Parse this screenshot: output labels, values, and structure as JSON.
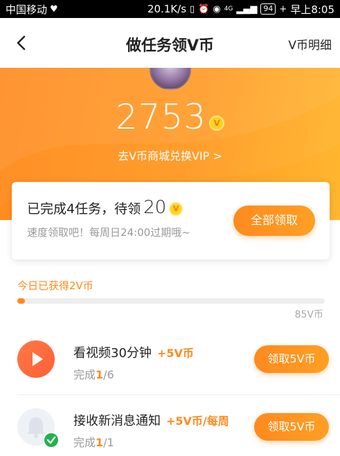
{
  "statusbar": {
    "carrier": "中国移动",
    "speed": "20.1K/s",
    "network": "4G",
    "battery": "94",
    "time": "早上8:05"
  },
  "nav": {
    "title": "做任务领V币",
    "right_link": "V币明细"
  },
  "hero": {
    "coin_total": "2753",
    "coin_symbol": "V",
    "exchange_link": "去V币商城兑换VIP >"
  },
  "summary_card": {
    "text_prefix": "已完成4任务，待领",
    "pending_amount": "20",
    "coin_symbol": "V",
    "hint": "速度领取吧！每周日24:00过期哦~",
    "claim_all_label": "全部领取"
  },
  "today": {
    "label": "今日已获得2V币",
    "progress_value": 2,
    "progress_max_label": "85V币"
  },
  "tasks": [
    {
      "icon": "play-icon",
      "name": "看视频30分钟",
      "reward": "+5V币",
      "progress_prefix": "完成",
      "progress_done": "1",
      "progress_total": "/6",
      "button": "领取5V币"
    },
    {
      "icon": "bell-icon",
      "name": "接收新消息通知",
      "reward": "+5V币/每周",
      "progress_prefix": "完成",
      "progress_done": "1",
      "progress_total": "/1",
      "button": "领取5V币"
    }
  ],
  "colors": {
    "accent": "#ff8a1e",
    "hero_gradient_end": "#ffb72f",
    "check_green": "#21b34c"
  }
}
